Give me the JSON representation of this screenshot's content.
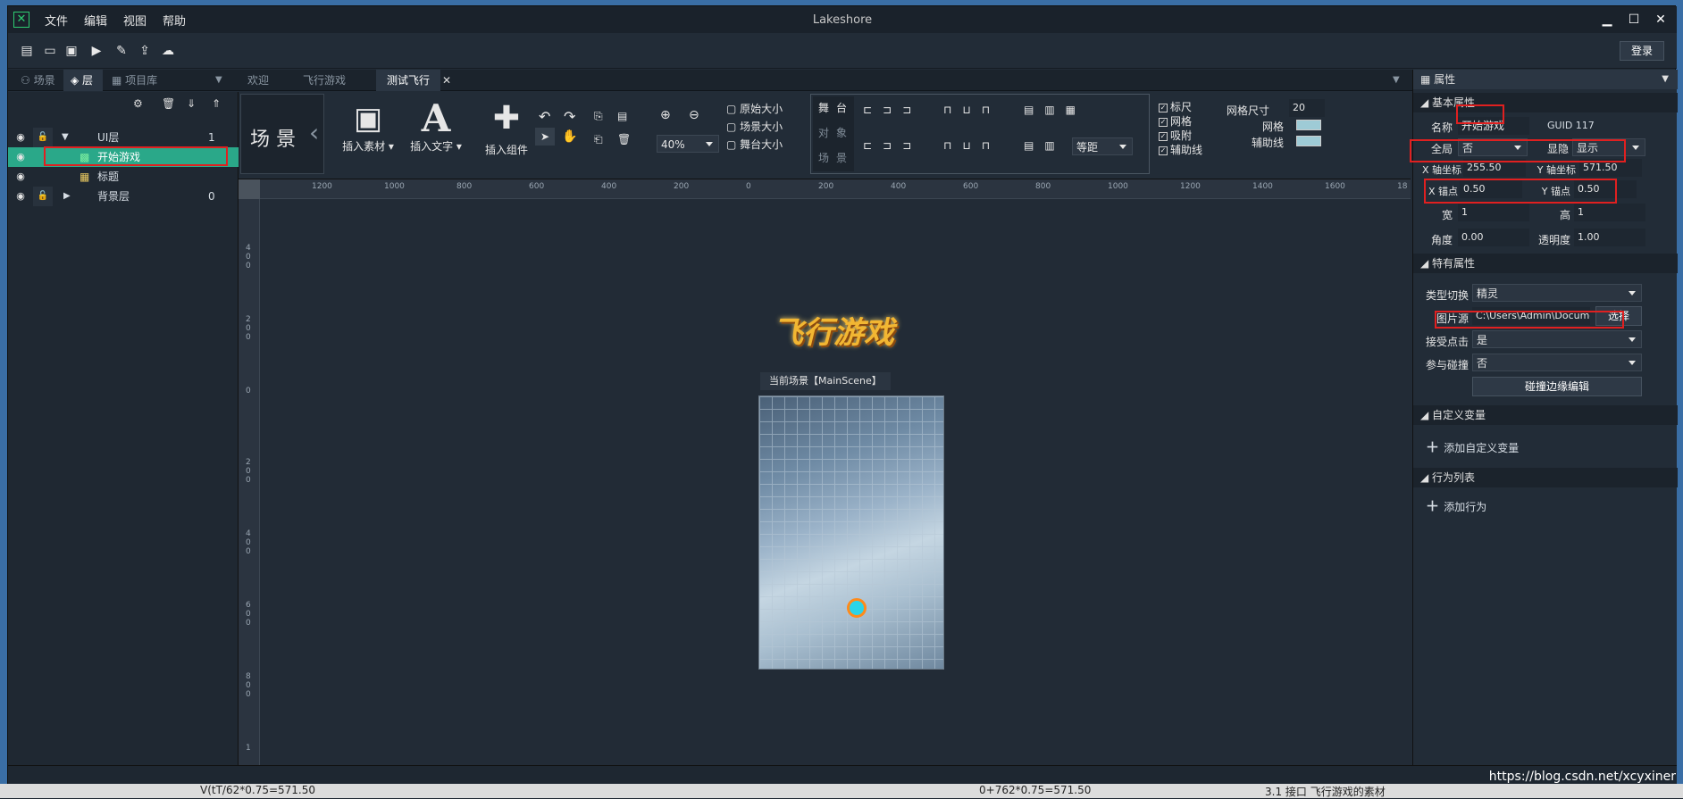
{
  "app": {
    "title": "Lakeshore",
    "menus": [
      "文件",
      "编辑",
      "视图",
      "帮助"
    ],
    "login": "登录"
  },
  "toolbar": {
    "icons": [
      "new-file-icon",
      "open-folder-icon",
      "save-icon",
      "play-icon",
      "clean-icon",
      "export-icon",
      "upload-cloud-icon"
    ]
  },
  "left_tabs": [
    "场景",
    "层",
    "项目库"
  ],
  "doc_tabs": [
    "欢迎",
    "飞行游戏",
    "测试飞行"
  ],
  "layers": [
    {
      "name": "UI层",
      "count": "1"
    },
    {
      "name": "开始游戏",
      "count": ""
    },
    {
      "name": "标题",
      "count": ""
    },
    {
      "name": "背景层",
      "count": "0"
    }
  ],
  "ribbon": {
    "scene_label": "场 景",
    "insert_asset": "插入素材",
    "insert_text": "插入文字",
    "insert_component": "插入组件",
    "zoom": "40%",
    "size_buttons": [
      "原始大小",
      "场景大小",
      "舞台大小"
    ],
    "align_words": [
      "舞",
      "台",
      "对",
      "象",
      "场",
      "景"
    ],
    "spacing": "等距",
    "checks": [
      "标尺",
      "网格",
      "吸附",
      "辅助线"
    ],
    "grid_size_label": "网格尺寸",
    "grid_size": "20",
    "grid_label": "网格",
    "guide_label": "辅助线"
  },
  "ruler": {
    "h": [
      "1200",
      "1000",
      "800",
      "600",
      "400",
      "200",
      "0",
      "200",
      "400",
      "600",
      "800",
      "1000",
      "1200",
      "1400",
      "1600",
      "18"
    ],
    "v": [
      "4\n0\n0",
      "2\n0\n0",
      "0",
      "2\n0\n0",
      "4\n0\n0",
      "6\n0\n0",
      "8\n0\n0",
      "1"
    ]
  },
  "canvas": {
    "game_logo": "飞行游戏",
    "scene_label": "当前场景【MainScene】"
  },
  "props": {
    "title": "属性",
    "basic": "基本属性",
    "name_label": "名称",
    "name": "开始游戏",
    "guid": "GUID 117",
    "global_label": "全局",
    "global": "否",
    "visible_label": "显隐",
    "visible": "显示",
    "x_label": "X 轴坐标",
    "x": "255.50",
    "y_label": "Y 轴坐标",
    "y": "571.50",
    "ax_label": "X 锚点",
    "ax": "0.50",
    "ay_label": "Y 锚点",
    "ay": "0.50",
    "w_label": "宽",
    "w": "1",
    "h_label": "高",
    "h": "1",
    "angle_label": "角度",
    "angle": "0.00",
    "alpha_label": "透明度",
    "alpha": "1.00",
    "special": "特有属性",
    "type_label": "类型切换",
    "type": "精灵",
    "img_label": "图片源",
    "img": "C:\\Users\\Admin\\Documen",
    "choose": "选择",
    "click_label": "接受点击",
    "click": "是",
    "collide_label": "参与碰撞",
    "collide": "否",
    "collide_edit": "碰撞边缘编辑",
    "custom_vars": "自定义变量",
    "add_var": "添加自定义变量",
    "behaviors": "行为列表",
    "add_behavior": "添加行为"
  },
  "watermark": "https://blog.csdn.net/xcyxiner",
  "taskbar": {
    "left": "V(tT/62*0.75=571.50",
    "mid": "0+762*0.75=571.50",
    "right": "3.1 接口 飞行游戏的素材"
  }
}
